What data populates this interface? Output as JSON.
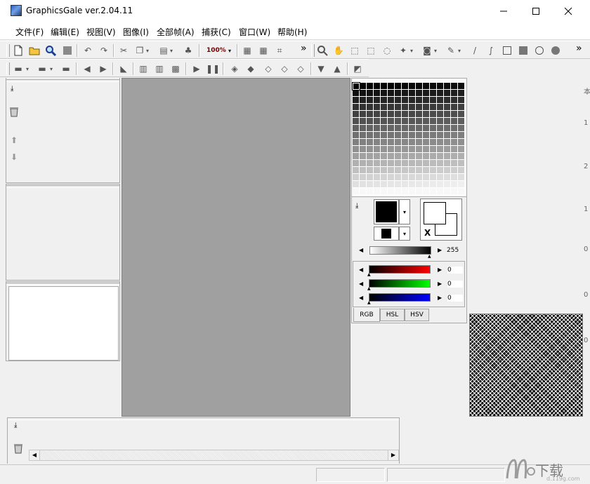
{
  "window": {
    "title": "GraphicsGale ver.2.04.11",
    "minimize_icon": "minimize-icon",
    "maximize_icon": "maximize-icon",
    "close_icon": "close-icon"
  },
  "menu": {
    "items": [
      "文件(F)",
      "编辑(E)",
      "视图(V)",
      "图像(I)",
      "全部帧(A)",
      "捕获(C)",
      "窗口(W)",
      "帮助(H)"
    ]
  },
  "toolbar1": {
    "zoom_label": "100%",
    "overflow": "»"
  },
  "color_panel": {
    "gray_value": "255",
    "red_value": "0",
    "green_value": "0",
    "blue_value": "0",
    "swap_mark": "X",
    "tabs": [
      "RGB",
      "HSL",
      "HSV"
    ],
    "active_tab": "RGB",
    "colors": {
      "red": "#ff0000",
      "green": "#00ff00",
      "blue": "#0000ff",
      "canvas": "#a0a0a0"
    }
  },
  "watermark": {
    "text": "下载",
    "site": "d.119g.com"
  },
  "right_edge_chars": [
    "本",
    "1",
    "2",
    "1",
    "0",
    "0",
    "0"
  ]
}
